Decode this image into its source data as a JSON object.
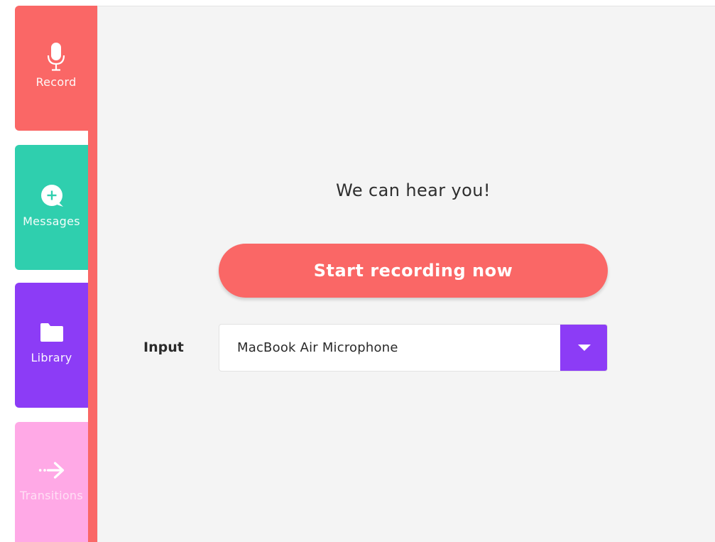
{
  "sidebar": {
    "tabs": [
      {
        "id": "record",
        "label": "Record",
        "icon": "microphone-icon",
        "color": "#fa6766"
      },
      {
        "id": "messages",
        "label": "Messages",
        "icon": "message-plus-icon",
        "color": "#2fcfae"
      },
      {
        "id": "library",
        "label": "Library",
        "icon": "folder-icon",
        "color": "#8c3cf6"
      },
      {
        "id": "transitions",
        "label": "Transitions",
        "icon": "arrow-right-icon",
        "color": "#ffa9e6"
      }
    ],
    "active_tab": "record"
  },
  "main": {
    "status_text": "We can hear you!",
    "start_button_label": "Start recording now",
    "input_label": "Input",
    "input_selected": "MacBook Air Microphone",
    "accent_color": "#fa6766",
    "dropdown_color": "#8c3cf6"
  }
}
